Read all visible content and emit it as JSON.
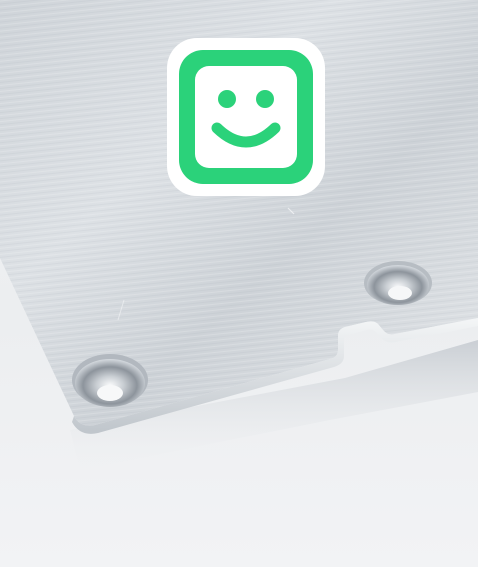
{
  "image": {
    "subject": "aluminum-plate-corner",
    "colors": {
      "background_light": "#f2f3f5",
      "plate_light": "#d9dde2",
      "plate_mid": "#c7ccd2",
      "plate_edge_shadow": "#9aa1a9",
      "hole_dark": "#7c838b",
      "badge_green": "#2bd27a",
      "badge_white": "#ffffff"
    },
    "logo": {
      "name": "smiley-face-logo",
      "shape": "rounded-square",
      "expression": "smile"
    }
  }
}
